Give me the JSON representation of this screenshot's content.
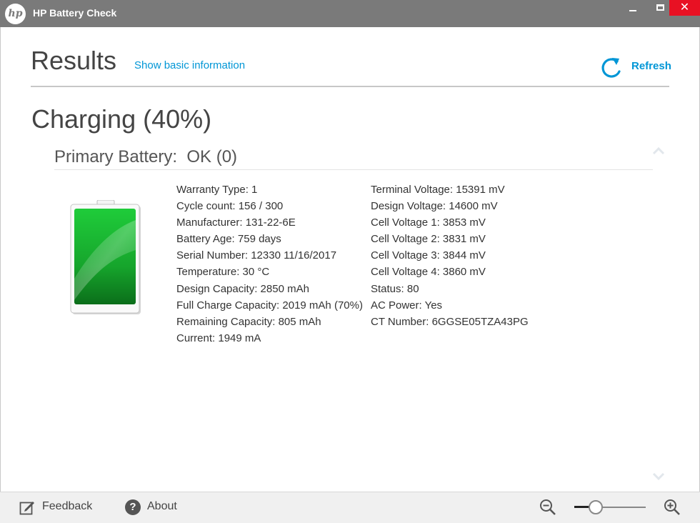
{
  "window": {
    "title": "HP Battery Check",
    "logo_text": "hp",
    "close_glyph": "✕"
  },
  "header": {
    "title": "Results",
    "show_basic_link": "Show basic information",
    "refresh_label": "Refresh"
  },
  "status": {
    "charging": "Charging (40%)",
    "charge_percent": 40,
    "primary_battery": "Primary Battery:  OK (0)"
  },
  "details_left": [
    "Warranty Type: 1",
    "Cycle count: 156 / 300",
    "Manufacturer: 131-22-6E",
    "Battery Age: 759 days",
    "Serial Number: 12330 11/16/2017",
    "Temperature: 30 °C",
    "Design Capacity: 2850 mAh",
    "Full Charge Capacity: 2019 mAh (70%)",
    "Remaining Capacity: 805 mAh",
    "Current: 1949 mA"
  ],
  "details_right": [
    "Terminal Voltage: 15391 mV",
    "Design Voltage: 14600 mV",
    "Cell Voltage 1: 3853 mV",
    "Cell Voltage 2: 3831 mV",
    "Cell Voltage 3: 3844 mV",
    "Cell Voltage 4: 3860 mV",
    "Status: 80",
    "AC Power: Yes",
    "CT Number: 6GGSE05TZA43PG"
  ],
  "footer": {
    "feedback_label": "Feedback",
    "about_label": "About",
    "about_glyph": "?",
    "zoom_level_fraction": 0.3
  },
  "colors": {
    "accent": "#0096d6",
    "titlebar": "#7a7a7a",
    "close": "#e81123",
    "battery_green": "#22b334"
  },
  "icons": [
    "hp-logo-icon",
    "minimize-icon",
    "maximize-icon",
    "close-icon",
    "refresh-icon",
    "chevron-up-icon",
    "chevron-down-icon",
    "battery-icon",
    "feedback-icon",
    "help-icon",
    "zoom-out-icon",
    "zoom-in-icon"
  ]
}
